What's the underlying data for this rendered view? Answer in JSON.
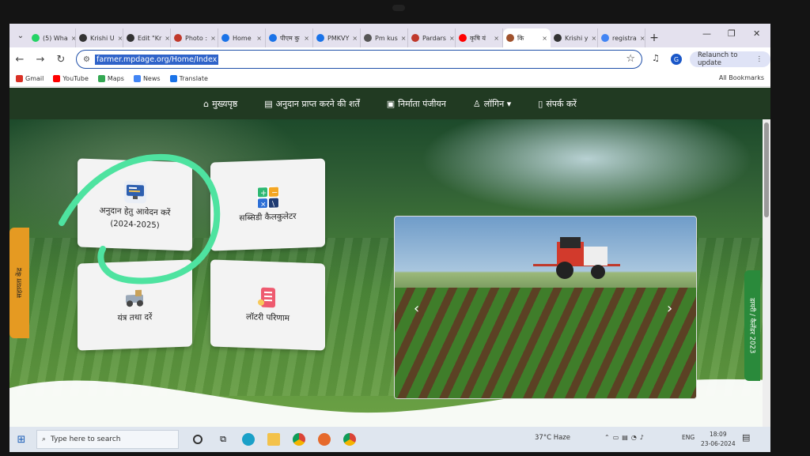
{
  "browser": {
    "tabs": [
      {
        "label": "(5) Wha",
        "color": "#25d366"
      },
      {
        "label": "Krishi U",
        "color": "#333333"
      },
      {
        "label": "Edit \"Kr",
        "color": "#333333"
      },
      {
        "label": "Photo :",
        "color": "#c0392b"
      },
      {
        "label": "Home",
        "color": "#1a73e8"
      },
      {
        "label": "पीएम कु",
        "color": "#1a73e8"
      },
      {
        "label": "PMKVY",
        "color": "#1a73e8"
      },
      {
        "label": "Pm kus",
        "color": "#555555"
      },
      {
        "label": "Pardars",
        "color": "#c0392b"
      },
      {
        "label": "कृषि यं",
        "color": "#ff0000"
      },
      {
        "label": "कि",
        "color": "#a0522d",
        "active": true
      },
      {
        "label": "Krishi y",
        "color": "#333333"
      },
      {
        "label": "registra",
        "color": "#4285f4"
      }
    ],
    "url": "farmer.mpdage.org/Home/Index",
    "relaunch_label": "Relaunch to update",
    "avatar_letter": "G",
    "bookmarks": [
      {
        "label": "Gmail",
        "color": "#d93025"
      },
      {
        "label": "YouTube",
        "color": "#ff0000"
      },
      {
        "label": "Maps",
        "color": "#34a853"
      },
      {
        "label": "News",
        "color": "#4285f4"
      },
      {
        "label": "Translate",
        "color": "#1a73e8"
      }
    ],
    "all_bookmarks_label": "All Bookmarks"
  },
  "site": {
    "nav": [
      {
        "icon": "home-icon",
        "glyph": "⌂",
        "label": "मुख्यपृष्ठ"
      },
      {
        "icon": "document-icon",
        "glyph": "▤",
        "label": "अनुदान प्राप्त करने की शर्तें"
      },
      {
        "icon": "id-card-icon",
        "glyph": "▣",
        "label": "निर्माता पंजीयन"
      },
      {
        "icon": "user-icon",
        "glyph": "♙",
        "label": "लॉगिन ▾"
      },
      {
        "icon": "book-icon",
        "glyph": "▯",
        "label": "संपर्क करें"
      }
    ],
    "cards": {
      "apply_title": "अनुदान हेतु आवेदन करें",
      "apply_year": "(2024-2025)",
      "calculator": "सब्सिडी कैलकुलेटर",
      "machinery": "यंत्र तथा दरें",
      "lottery": "लॉटरी परिणाम"
    },
    "helpdesk_label": "सहायता केंद्र",
    "calendar_label": "डायरी / कैलेंडर 2023",
    "highlight_color": "#4ee3a0"
  },
  "taskbar": {
    "search_placeholder": "Type here to search",
    "weather": "37°C  Haze",
    "language": "ENG",
    "time": "18:09",
    "date": "23-06-2024"
  }
}
